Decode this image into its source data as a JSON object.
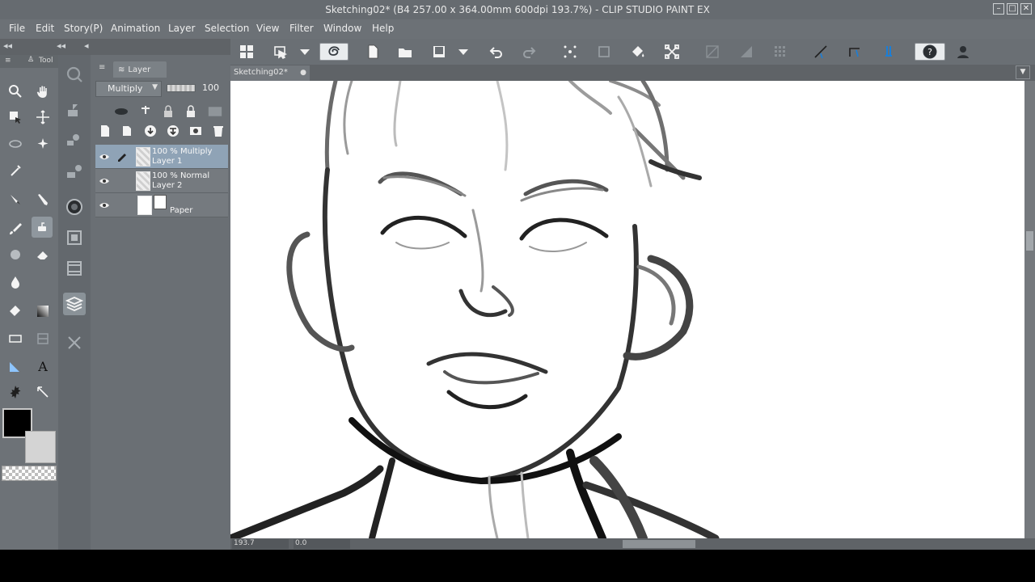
{
  "window": {
    "title": "Sketching02* (B4 257.00 x 364.00mm 600dpi 193.7%) - CLIP STUDIO PAINT EX",
    "controls": [
      "minimize",
      "maximize",
      "close"
    ]
  },
  "menu": {
    "items": [
      "File",
      "Edit",
      "Story(P)",
      "Animation",
      "Layer",
      "Selection",
      "View",
      "Filter",
      "Window",
      "Help"
    ]
  },
  "command_bar": {
    "icons": [
      "grid-icon",
      "app-switch-icon",
      "dropdown-arrow-icon",
      "clip-studio-icon",
      "new-file-icon",
      "open-folder-icon",
      "save-icon",
      "dropdown-arrow-icon",
      "undo-icon",
      "redo-icon",
      "snap-point-icon",
      "transform-box-icon",
      "fill-icon",
      "transform-icon",
      "clear-outside-icon",
      "clear-icon",
      "tone-icon",
      "snap-ruler-icon",
      "snap-special-ruler-icon",
      "snap-grid-icon",
      "help-icon",
      "user-icon"
    ]
  },
  "tool_panel": {
    "title": "Tool",
    "tools": [
      "zoom-tool",
      "hand-tool",
      "operation-tool",
      "move-tool",
      "lasso-tool",
      "auto-select-tool",
      "eyedropper-tool",
      "pen-tool",
      "marker-tool",
      "pencil-tool",
      "brush-tool",
      "airbrush-tool",
      "eraser-tool",
      "blend-tool",
      "fill-tool",
      "gradient-tool",
      "figure-tool",
      "frame-tool",
      "ruler-tool",
      "text-tool",
      "balloon-tool",
      "correct-line-tool"
    ],
    "colors": {
      "main": "#000000",
      "sub": "#d4d4d4"
    }
  },
  "layer_panel": {
    "tab_label": "Layer",
    "blend_mode": "Multiply",
    "opacity": "100",
    "layers": [
      {
        "line1": "100 % Multiply",
        "line2": "Layer 1",
        "selected": true
      },
      {
        "line1": "100 % Normal",
        "line2": "Layer 2",
        "selected": false
      },
      {
        "line1": "",
        "line2": "Paper",
        "selected": false
      }
    ]
  },
  "document": {
    "tab": "Sketching02*",
    "zoom": "193.7",
    "angle": "0.0"
  }
}
